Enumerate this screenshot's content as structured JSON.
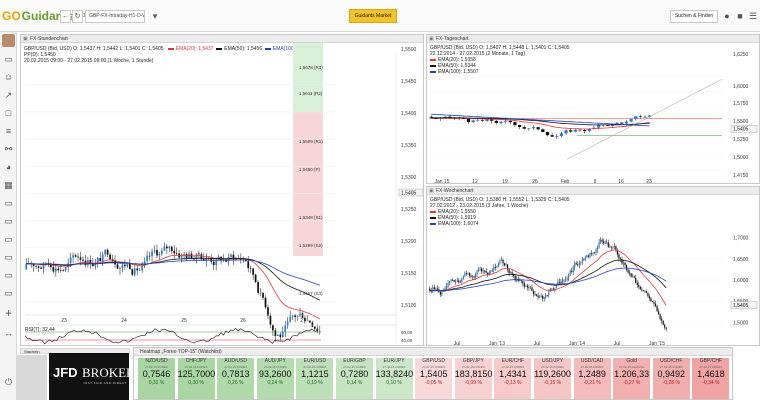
{
  "topbar": {
    "logo_prefix": "GO",
    "logo_name": "Guidants",
    "logo_sup": "PRO",
    "back_label": "←",
    "refresh_label": "↻",
    "address": "GBP-FX-Intraday-H1-D-W",
    "market_button": "Guidants Market",
    "search_button": "Suchen & Finden"
  },
  "sidebar": {
    "icons": [
      "monitor-icon",
      "person-icon",
      "chart-icon",
      "bar-chart-icon",
      "list-icon",
      "link-icon",
      "speedometer-icon",
      "grid-icon",
      "monitor-icon",
      "monitor-icon",
      "monitor-icon",
      "monitor-icon",
      "monitor-icon",
      "plus-icon",
      "arrow-icon",
      "power-icon"
    ]
  },
  "panel_left": {
    "title": "FX-Stundenchart",
    "legend_line1": "GBP/USD (Bid, USD)  O: 1,5437  H: 1,5442  L: 1,5401  C: 1,5405",
    "ema20": "EMA(20): 1,5437",
    "ema50": "EMA(50): 1,5456",
    "ema100": "EMA(100): 1,5453",
    "pivot": "PP(D): 1,5450",
    "range": "20.02.2015 09:00 - 27.02.2015 09:00 (1 Woche, 1 Stunde)",
    "price_labels": [
      "1,5500",
      "1,5450",
      "1,5400",
      "1,5350",
      "1,5300",
      "1,5250",
      "1,5200",
      "1,5150",
      "1,5100"
    ],
    "last_price": "1,5405",
    "pivot_levels": [
      "1,5678 (R3)",
      "1,5611 (R2)",
      "1,5509 (R1)",
      "1,5450 (P)",
      "1,5348 (S1)",
      "1,5289 (S2)",
      "1,5187 (S3)"
    ],
    "dates": [
      "23",
      "24",
      "25",
      "26",
      "27"
    ],
    "rsi_label": "RSI(7): 32,44",
    "rsi_levels": [
      "60,00",
      "40,00"
    ]
  },
  "panel_tr": {
    "title": "FX-Tageschart",
    "legend_line1": "GBP/USD (Bid, USD)  O: 1,5407  H: 1,5448  L: 1,5401  C: 1,5405",
    "range": "22.12.2014 - 27.02.2015 (2 Monate, 1 Tag)",
    "ema20": "EMA(20): 1,5358",
    "ema50": "EMA(50): 1,5344",
    "ema100": "EMA(100): 1,5507",
    "price_labels": [
      "1,6250",
      "1,6000",
      "1,5750",
      "1,5500",
      "1,5250",
      "1,5000",
      "1,4750"
    ],
    "last_price": "1,5405",
    "dates": [
      "Jan 15",
      "12",
      "19",
      "26",
      "Feb",
      "9",
      "16",
      "23"
    ]
  },
  "panel_br": {
    "title": "FX-Wochenchart",
    "legend_line1": "GBP/USD (Bid, USD)  O: 1,5380  H: 1,5552  L: 1,5329  C: 1,5405",
    "range": "27.02.2012 - 23.02.2015 (3 Jahre, 1 Woche)",
    "ema20": "EMA(20): 1,5550",
    "ema50": "EMA(50): 1,5919",
    "ema100": "EMA(100): 1,6074",
    "price_labels": [
      "1,7000",
      "1,6500",
      "1,6000",
      "1,5500",
      "1,5000"
    ],
    "last_price": "1,5405",
    "dates": [
      "Jul",
      "Jan '13",
      "Jul",
      "Jan '14",
      "Jul",
      "Jan '15"
    ]
  },
  "ticker": {
    "title": "Heatmap „Forex-TOP-15“ (Watchlist)",
    "items": [
      {
        "name": "NZD/USD",
        "time": "27.02.15 FOREX",
        "value": "0,7546",
        "change": "0,31 %",
        "pos": true
      },
      {
        "name": "CHF/JPY",
        "time": "27.02.15 FOREX",
        "value": "125,7000",
        "change": "0,30 %",
        "pos": true
      },
      {
        "name": "AUD/USD",
        "time": "27.02.15 FOREX",
        "value": "0,7813",
        "change": "0,26 %",
        "pos": true
      },
      {
        "name": "AUD/JPY",
        "time": "27.02.15 FOREX",
        "value": "93,2600",
        "change": "0,24 %",
        "pos": true
      },
      {
        "name": "EUR/USD",
        "time": "27.02.15 FOREX",
        "value": "1,1215",
        "change": "0,19 %",
        "pos": true
      },
      {
        "name": "EUR/GBP",
        "time": "27.02.15 FOREX",
        "value": "0,7280",
        "change": "0,14 %",
        "pos": true
      },
      {
        "name": "EUR/JPY",
        "time": "27.02.15 FOREX",
        "value": "133,8240",
        "change": "0,10 %",
        "pos": true
      },
      {
        "name": "GBP/USD",
        "time": "27.02.15 FOREX",
        "value": "1,5405",
        "change": "-0,05 %",
        "pos": false
      },
      {
        "name": "GBP/JPY",
        "time": "27.02.15 FOREX",
        "value": "183,8150",
        "change": "-0,09 %",
        "pos": false
      },
      {
        "name": "EUR/CHF",
        "time": "27.02.15 FOREX",
        "value": "1,4341",
        "change": "-0,13 %",
        "pos": false
      },
      {
        "name": "USD/JPY",
        "time": "27.02.15 FOREX",
        "value": "119,2600",
        "change": "-0,15 %",
        "pos": false
      },
      {
        "name": "USD/CAD",
        "time": "27.02.15 FOREX",
        "value": "1,2489",
        "change": "-0,21 %",
        "pos": false
      },
      {
        "name": "Gold",
        "time": "27.02.15 Deutsche",
        "value": "1.206,33",
        "change": "-0,27 %",
        "pos": false
      },
      {
        "name": "USD/CHF",
        "time": "27.02.15 FOREX",
        "value": "0,9492",
        "change": "-0,28 %",
        "pos": false
      },
      {
        "name": "GBP/CHF",
        "time": "27.02.15 FOREX",
        "value": "1,4618",
        "change": "-0,34 %",
        "pos": false
      }
    ]
  },
  "jfd": {
    "brand_a": "JFD",
    "brand_b": "BROKERS",
    "tagline": "JUST FAIR AND DIRECT"
  },
  "colors": {
    "up": "#2a7fd4",
    "down": "#111111",
    "ema20": "#e0383b",
    "ema50": "#111111",
    "ema100": "#2244bb",
    "green": "#3a9a3a",
    "red": "#d33"
  }
}
